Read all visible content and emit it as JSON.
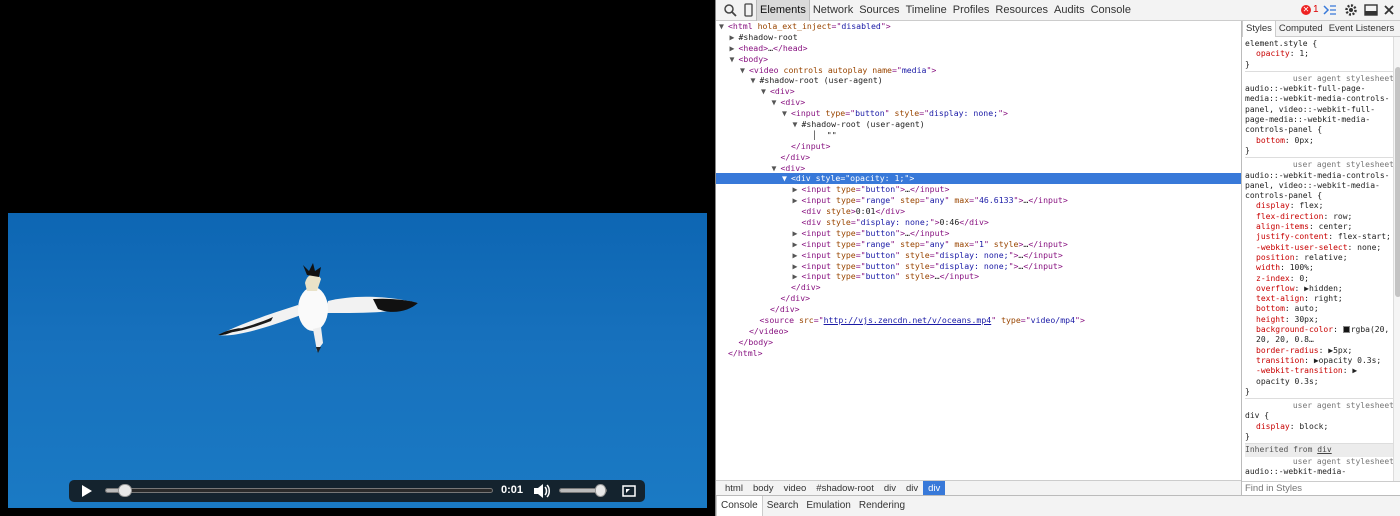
{
  "video": {
    "time_current": "0:01",
    "progress_fraction": 0.033,
    "volume_fraction": 1.0,
    "colors": {
      "sky_top": "#0d66b3",
      "sky_bottom": "#1a7ac4",
      "controls_bg": "#141414"
    }
  },
  "devtools": {
    "tabs": [
      "Elements",
      "Network",
      "Sources",
      "Timeline",
      "Profiles",
      "Resources",
      "Audits",
      "Console"
    ],
    "active_tab": "Elements",
    "error_count": "1",
    "tree": [
      {
        "d": 0,
        "a": "▼",
        "parts": [
          [
            "t",
            "<html "
          ],
          [
            "n",
            "hola_ext_inject"
          ],
          [
            "t",
            "=\""
          ],
          [
            "v",
            "disabled"
          ],
          [
            "t",
            "\">"
          ]
        ]
      },
      {
        "d": 1,
        "a": "▶",
        "parts": [
          [
            "p",
            "#shadow-root"
          ]
        ]
      },
      {
        "d": 1,
        "a": "▶",
        "parts": [
          [
            "t",
            "<head>"
          ],
          [
            "p",
            "…"
          ],
          [
            "t",
            "</head>"
          ]
        ]
      },
      {
        "d": 1,
        "a": "▼",
        "parts": [
          [
            "t",
            "<body>"
          ]
        ]
      },
      {
        "d": 2,
        "a": "▼",
        "parts": [
          [
            "t",
            "<video "
          ],
          [
            "n",
            "controls autoplay name"
          ],
          [
            "t",
            "=\""
          ],
          [
            "v",
            "media"
          ],
          [
            "t",
            "\">"
          ]
        ]
      },
      {
        "d": 3,
        "a": "▼",
        "parts": [
          [
            "p",
            "#shadow-root (user-agent)"
          ]
        ]
      },
      {
        "d": 4,
        "a": "▼",
        "parts": [
          [
            "t",
            "<div>"
          ]
        ]
      },
      {
        "d": 5,
        "a": "▼",
        "parts": [
          [
            "t",
            "<div>"
          ]
        ]
      },
      {
        "d": 6,
        "a": "▼",
        "parts": [
          [
            "t",
            "<input "
          ],
          [
            "n",
            "type"
          ],
          [
            "t",
            "=\""
          ],
          [
            "v",
            "button"
          ],
          [
            "t",
            "\" "
          ],
          [
            "n",
            "style"
          ],
          [
            "t",
            "=\""
          ],
          [
            "v",
            "display: none;"
          ],
          [
            "t",
            "\">"
          ]
        ]
      },
      {
        "d": 7,
        "a": "▼",
        "parts": [
          [
            "p",
            "#shadow-root (user-agent)"
          ]
        ]
      },
      {
        "d": 8,
        "a": " ",
        "parts": [
          [
            "p",
            "│  \"\""
          ]
        ]
      },
      {
        "d": 6,
        "a": " ",
        "parts": [
          [
            "t",
            "</input>"
          ]
        ]
      },
      {
        "d": 5,
        "a": " ",
        "parts": [
          [
            "t",
            "</div>"
          ]
        ]
      },
      {
        "d": 5,
        "a": "▼",
        "parts": [
          [
            "t",
            "<div>"
          ]
        ]
      },
      {
        "d": 6,
        "a": "▼",
        "sel": true,
        "parts": [
          [
            "t",
            "<div "
          ],
          [
            "n",
            "style"
          ],
          [
            "t",
            "=\""
          ],
          [
            "v",
            "opacity: 1;"
          ],
          [
            "t",
            "\">"
          ]
        ]
      },
      {
        "d": 7,
        "a": "▶",
        "parts": [
          [
            "t",
            "<input "
          ],
          [
            "n",
            "type"
          ],
          [
            "t",
            "=\""
          ],
          [
            "v",
            "button"
          ],
          [
            "t",
            "\">"
          ],
          [
            "p",
            "…"
          ],
          [
            "t",
            "</input>"
          ]
        ]
      },
      {
        "d": 7,
        "a": "▶",
        "parts": [
          [
            "t",
            "<input "
          ],
          [
            "n",
            "type"
          ],
          [
            "t",
            "=\""
          ],
          [
            "v",
            "range"
          ],
          [
            "t",
            "\" "
          ],
          [
            "n",
            "step"
          ],
          [
            "t",
            "=\""
          ],
          [
            "v",
            "any"
          ],
          [
            "t",
            "\" "
          ],
          [
            "n",
            "max"
          ],
          [
            "t",
            "=\""
          ],
          [
            "v",
            "46.6133"
          ],
          [
            "t",
            "\">"
          ],
          [
            "p",
            "…"
          ],
          [
            "t",
            "</input>"
          ]
        ]
      },
      {
        "d": 7,
        "a": " ",
        "parts": [
          [
            "t",
            "<div "
          ],
          [
            "n",
            "style"
          ],
          [
            "t",
            ">"
          ],
          [
            "p",
            "0:01"
          ],
          [
            "t",
            "</div>"
          ]
        ]
      },
      {
        "d": 7,
        "a": " ",
        "parts": [
          [
            "t",
            "<div "
          ],
          [
            "n",
            "style"
          ],
          [
            "t",
            "=\""
          ],
          [
            "v",
            "display: none;"
          ],
          [
            "t",
            "\">"
          ],
          [
            "p",
            "0:46"
          ],
          [
            "t",
            "</div>"
          ]
        ]
      },
      {
        "d": 7,
        "a": "▶",
        "parts": [
          [
            "t",
            "<input "
          ],
          [
            "n",
            "type"
          ],
          [
            "t",
            "=\""
          ],
          [
            "v",
            "button"
          ],
          [
            "t",
            "\">"
          ],
          [
            "p",
            "…"
          ],
          [
            "t",
            "</input>"
          ]
        ]
      },
      {
        "d": 7,
        "a": "▶",
        "parts": [
          [
            "t",
            "<input "
          ],
          [
            "n",
            "type"
          ],
          [
            "t",
            "=\""
          ],
          [
            "v",
            "range"
          ],
          [
            "t",
            "\" "
          ],
          [
            "n",
            "step"
          ],
          [
            "t",
            "=\""
          ],
          [
            "v",
            "any"
          ],
          [
            "t",
            "\" "
          ],
          [
            "n",
            "max"
          ],
          [
            "t",
            "=\""
          ],
          [
            "v",
            "1"
          ],
          [
            "t",
            "\" "
          ],
          [
            "n",
            "style"
          ],
          [
            "t",
            ">"
          ],
          [
            "p",
            "…"
          ],
          [
            "t",
            "</input>"
          ]
        ]
      },
      {
        "d": 7,
        "a": "▶",
        "parts": [
          [
            "t",
            "<input "
          ],
          [
            "n",
            "type"
          ],
          [
            "t",
            "=\""
          ],
          [
            "v",
            "button"
          ],
          [
            "t",
            "\" "
          ],
          [
            "n",
            "style"
          ],
          [
            "t",
            "=\""
          ],
          [
            "v",
            "display: none;"
          ],
          [
            "t",
            "\">"
          ],
          [
            "p",
            "…"
          ],
          [
            "t",
            "</input>"
          ]
        ]
      },
      {
        "d": 7,
        "a": "▶",
        "parts": [
          [
            "t",
            "<input "
          ],
          [
            "n",
            "type"
          ],
          [
            "t",
            "=\""
          ],
          [
            "v",
            "button"
          ],
          [
            "t",
            "\" "
          ],
          [
            "n",
            "style"
          ],
          [
            "t",
            "=\""
          ],
          [
            "v",
            "display: none;"
          ],
          [
            "t",
            "\">"
          ],
          [
            "p",
            "…"
          ],
          [
            "t",
            "</input>"
          ]
        ]
      },
      {
        "d": 7,
        "a": "▶",
        "parts": [
          [
            "t",
            "<input "
          ],
          [
            "n",
            "type"
          ],
          [
            "t",
            "=\""
          ],
          [
            "v",
            "button"
          ],
          [
            "t",
            "\" "
          ],
          [
            "n",
            "style"
          ],
          [
            "t",
            ">"
          ],
          [
            "p",
            "…"
          ],
          [
            "t",
            "</input>"
          ]
        ]
      },
      {
        "d": 6,
        "a": " ",
        "parts": [
          [
            "t",
            "</div>"
          ]
        ]
      },
      {
        "d": 5,
        "a": " ",
        "parts": [
          [
            "t",
            "</div>"
          ]
        ]
      },
      {
        "d": 4,
        "a": " ",
        "parts": [
          [
            "t",
            "</div>"
          ]
        ]
      },
      {
        "d": 3,
        "a": " ",
        "parts": [
          [
            "t",
            "<source "
          ],
          [
            "n",
            "src"
          ],
          [
            "t",
            "=\""
          ],
          [
            "l",
            "http://vjs.zencdn.net/v/oceans.mp4"
          ],
          [
            "t",
            "\" "
          ],
          [
            "n",
            "type"
          ],
          [
            "t",
            "=\""
          ],
          [
            "v",
            "video/mp4"
          ],
          [
            "t",
            "\">"
          ]
        ]
      },
      {
        "d": 2,
        "a": " ",
        "parts": [
          [
            "t",
            "</video>"
          ]
        ]
      },
      {
        "d": 1,
        "a": " ",
        "parts": [
          [
            "t",
            "</body>"
          ]
        ]
      },
      {
        "d": 0,
        "a": " ",
        "parts": [
          [
            "t",
            "</html>"
          ]
        ]
      }
    ],
    "breadcrumb": [
      "html",
      "body",
      "video",
      "#shadow-root",
      "div",
      "div",
      "div"
    ],
    "breadcrumb_active_index": 6,
    "drawer_tabs": [
      "Console",
      "Search",
      "Emulation",
      "Rendering"
    ],
    "sidebar": {
      "tabs": [
        "Styles",
        "Computed",
        "Event Listeners"
      ],
      "find_placeholder": "Find in Styles",
      "rules": [
        {
          "selector": "element.style {",
          "source": "",
          "props": [
            [
              "opacity",
              "1;"
            ]
          ]
        },
        {
          "selector": "audio::-webkit-full-page-media::-webkit-media-controls-panel, video::-webkit-full-page-media::-webkit-media-controls-panel {",
          "source": "user agent stylesheet",
          "props": [
            [
              "bottom",
              "0px;"
            ]
          ]
        },
        {
          "selector": "audio::-webkit-media-controls-panel, video::-webkit-media-controls-panel {",
          "source": "user agent stylesheet",
          "props": [
            [
              "display",
              "flex;"
            ],
            [
              "flex-direction",
              "row;"
            ],
            [
              "align-items",
              "center;"
            ],
            [
              "justify-content",
              "flex-start;"
            ],
            [
              "-webkit-user-select",
              "none;"
            ],
            [
              "position",
              "relative;"
            ],
            [
              "width",
              "100%;"
            ],
            [
              "z-index",
              "0;"
            ],
            [
              "overflow",
              "▶hidden;"
            ],
            [
              "text-align",
              "right;"
            ],
            [
              "bottom",
              "auto;"
            ],
            [
              "height",
              "30px;"
            ],
            [
              "background-color",
              "rgba(20, 20, 20, 0.8…"
            ],
            [
              "border-radius",
              "▶5px;"
            ],
            [
              "transition",
              "▶opacity 0.3s;"
            ],
            [
              "-webkit-transition",
              "▶ opacity 0.3s;"
            ]
          ]
        },
        {
          "selector": "div {",
          "source": "user agent stylesheet",
          "props": [
            [
              "display",
              "block;"
            ]
          ]
        }
      ],
      "inherited_label": "Inherited from ",
      "inherited_link": "div",
      "trailing_source": "user agent stylesheet",
      "trailing_selector": "audio::-webkit-media-"
    }
  }
}
